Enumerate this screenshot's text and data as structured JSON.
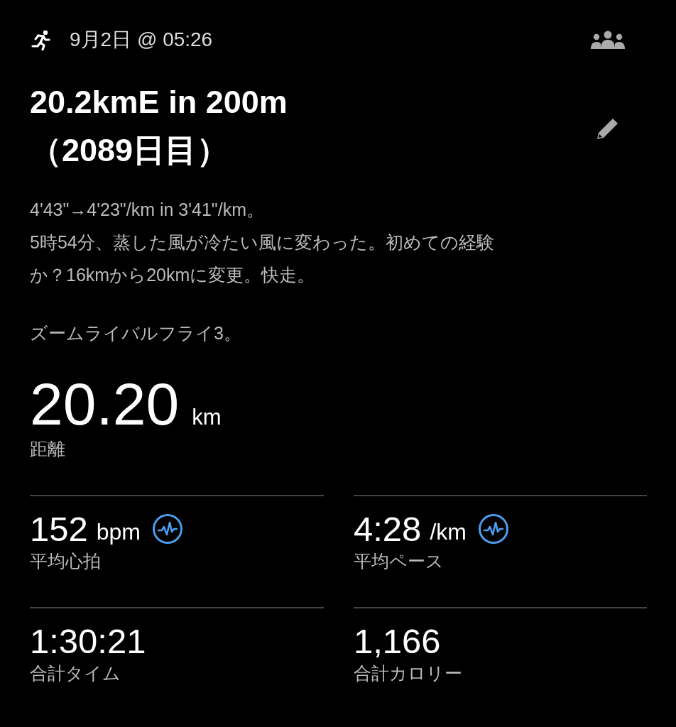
{
  "header": {
    "datetime": "9月2日 @ 05:26"
  },
  "title_lines": [
    "20.2kmE in 200m",
    "（2089日目）"
  ],
  "description_lines": [
    "4'43\"→4'23\"/km in 3'41\"/km。",
    "5時54分、蒸した風が冷たい風に変わった。初めての経験",
    "か？16kmから20kmに変更。快走。"
  ],
  "gear": "ズームライバルフライ3。",
  "distance": {
    "value": "20.20",
    "unit": "km",
    "label": "距離"
  },
  "stats": [
    {
      "value": "152",
      "unit": "bpm",
      "label": "平均心拍",
      "chart_link": true
    },
    {
      "value": "4:28",
      "unit": "/km",
      "label": "平均ペース",
      "chart_link": true
    },
    {
      "value": "1:30:21",
      "label": "合計タイム",
      "chart_link": false
    },
    {
      "value": "1,166",
      "label": "合計カロリー",
      "chart_link": false
    }
  ]
}
